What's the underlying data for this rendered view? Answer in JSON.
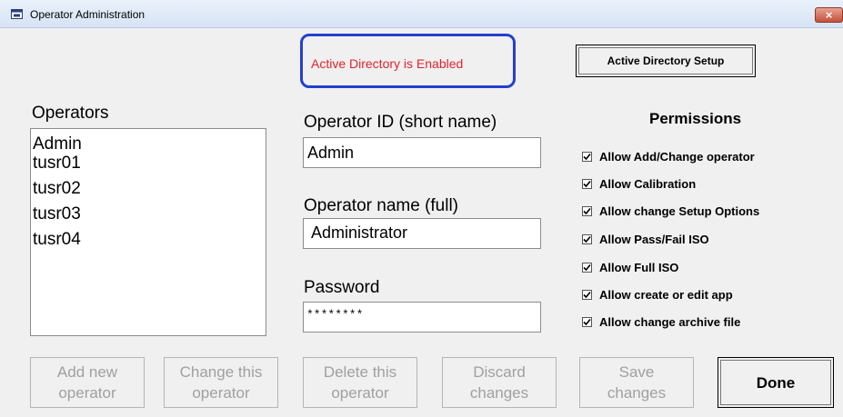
{
  "window": {
    "title": "Operator Administration",
    "close_label": "×"
  },
  "active_directory": {
    "status_text": "Active Directory is Enabled",
    "status_color": "#e3232e",
    "setup_button_label": "Active Directory Setup"
  },
  "operators": {
    "label": "Operators",
    "items": [
      "Admin",
      "tusr01",
      "tusr02",
      "tusr03",
      "tusr04"
    ]
  },
  "form": {
    "operator_id_label": "Operator ID (short name)",
    "operator_id_value": "Admin",
    "operator_name_label": "Operator name (full)",
    "operator_name_value": "Administrator",
    "password_label": "Password",
    "password_value": "********"
  },
  "permissions": {
    "title": "Permissions",
    "items": [
      {
        "label": "Allow Add/Change operator",
        "checked": true
      },
      {
        "label": "Allow Calibration",
        "checked": true
      },
      {
        "label": "Allow change Setup Options",
        "checked": true
      },
      {
        "label": "Allow Pass/Fail ISO",
        "checked": true
      },
      {
        "label": "Allow Full ISO",
        "checked": true
      },
      {
        "label": "Allow create or edit app",
        "checked": true
      },
      {
        "label": "Allow change archive file",
        "checked": true
      }
    ]
  },
  "buttons": {
    "add_new": {
      "line1": "Add new",
      "line2": "operator",
      "enabled": false
    },
    "change": {
      "line1": "Change this",
      "line2": "operator",
      "enabled": false
    },
    "delete": {
      "line1": "Delete this",
      "line2": "operator",
      "enabled": false
    },
    "discard": {
      "line1": "Discard",
      "line2": "changes",
      "enabled": false
    },
    "save": {
      "line1": "Save",
      "line2": "changes",
      "enabled": false
    },
    "done": {
      "label": "Done",
      "enabled": true
    }
  },
  "colors": {
    "ad_border": "#2440cf",
    "disabled_text": "#a0a0a0"
  }
}
